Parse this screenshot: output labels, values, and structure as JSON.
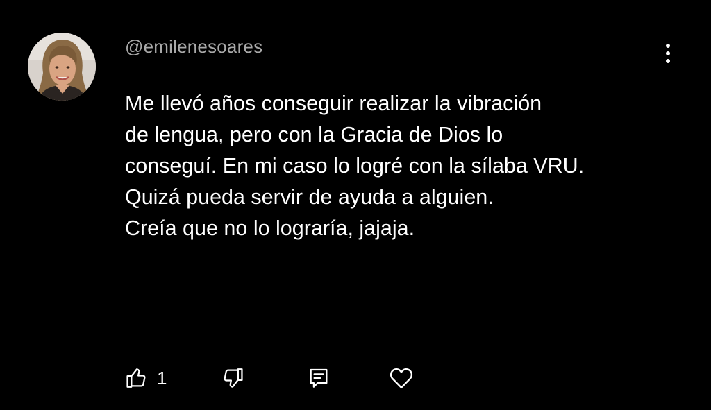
{
  "comment": {
    "author": "@emilenesoares",
    "avatar_icon": "user-avatar-photo",
    "lines": [
      "Me llevó años conseguir realizar la vibración",
      "de lengua, pero con la Gracia de Dios lo",
      "conseguí. En mi caso lo logré con la sílaba VRU.",
      "Quizá pueda servir de ayuda a alguien.",
      "Creía que no lo lograría, jajaja."
    ],
    "like_count": "1"
  },
  "actions": {
    "like_icon": "thumbs-up-icon",
    "dislike_icon": "thumbs-down-icon",
    "reply_icon": "reply-comment-icon",
    "heart_icon": "heart-icon",
    "menu_icon": "more-vertical-icon"
  },
  "colors": {
    "background": "#000000",
    "text": "#ffffff",
    "username": "#a9a9a9"
  }
}
